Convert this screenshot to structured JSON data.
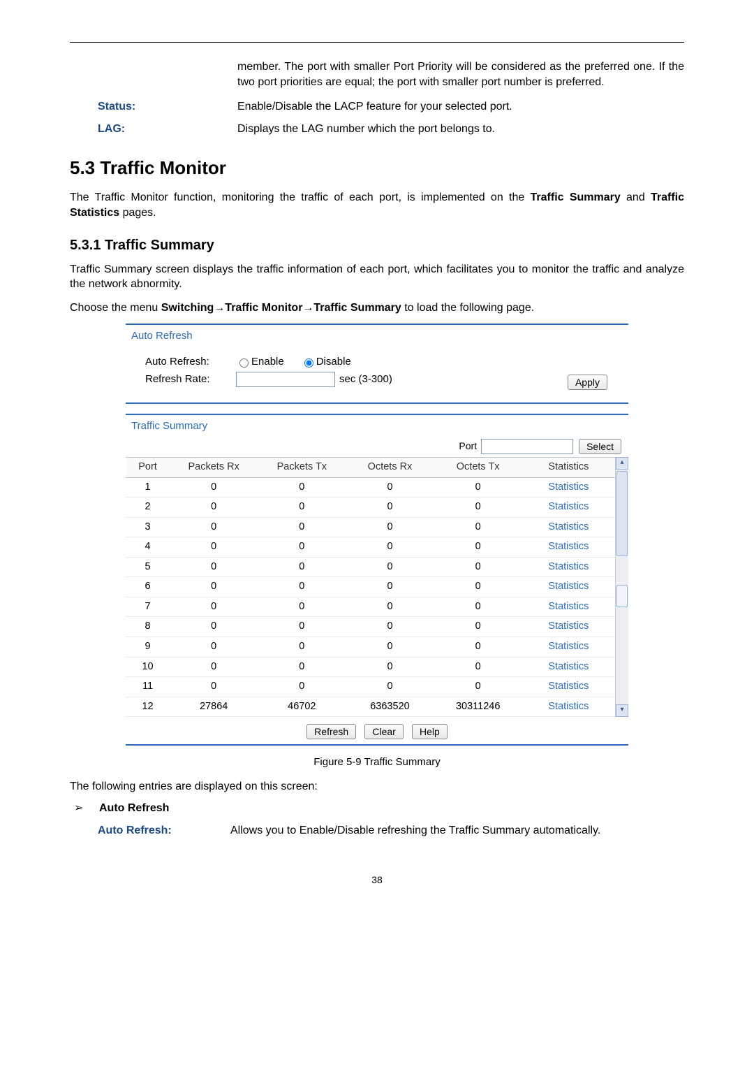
{
  "top_continuation": "member. The port with smaller Port Priority will be considered as the preferred one. If the two port priorities are equal; the port with smaller port number is preferred.",
  "defs": {
    "status_label": "Status:",
    "status_text": "Enable/Disable the LACP feature for your selected port.",
    "lag_label": "LAG:",
    "lag_text": "Displays the LAG number which the port belongs to."
  },
  "sec_heading": "5.3  Traffic Monitor",
  "sec_intro": "The Traffic Monitor function, monitoring the traffic of each port, is implemented on the Traffic Summary and Traffic Statistics pages.",
  "sub_heading": "5.3.1 Traffic Summary",
  "sub_intro": "Traffic Summary screen displays the traffic information of each port, which facilitates you to monitor the traffic and analyze the network abnormity.",
  "menu_path_line": "Choose the menu Switching→Traffic Monitor→Traffic Summary to load the following page.",
  "auto_refresh": {
    "header": "Auto Refresh",
    "label": "Auto Refresh:",
    "enable": "Enable",
    "disable": "Disable",
    "rate_label": "Refresh Rate:",
    "rate_unit": "sec (3-300)",
    "apply": "Apply"
  },
  "traffic_summary": {
    "header": "Traffic Summary",
    "port_label": "Port",
    "select_btn": "Select",
    "columns": [
      "Port",
      "Packets Rx",
      "Packets Tx",
      "Octets Rx",
      "Octets Tx",
      "Statistics"
    ],
    "rows": [
      {
        "port": "1",
        "prx": "0",
        "ptx": "0",
        "orx": "0",
        "otx": "0",
        "stat": "Statistics"
      },
      {
        "port": "2",
        "prx": "0",
        "ptx": "0",
        "orx": "0",
        "otx": "0",
        "stat": "Statistics"
      },
      {
        "port": "3",
        "prx": "0",
        "ptx": "0",
        "orx": "0",
        "otx": "0",
        "stat": "Statistics"
      },
      {
        "port": "4",
        "prx": "0",
        "ptx": "0",
        "orx": "0",
        "otx": "0",
        "stat": "Statistics"
      },
      {
        "port": "5",
        "prx": "0",
        "ptx": "0",
        "orx": "0",
        "otx": "0",
        "stat": "Statistics"
      },
      {
        "port": "6",
        "prx": "0",
        "ptx": "0",
        "orx": "0",
        "otx": "0",
        "stat": "Statistics"
      },
      {
        "port": "7",
        "prx": "0",
        "ptx": "0",
        "orx": "0",
        "otx": "0",
        "stat": "Statistics"
      },
      {
        "port": "8",
        "prx": "0",
        "ptx": "0",
        "orx": "0",
        "otx": "0",
        "stat": "Statistics"
      },
      {
        "port": "9",
        "prx": "0",
        "ptx": "0",
        "orx": "0",
        "otx": "0",
        "stat": "Statistics"
      },
      {
        "port": "10",
        "prx": "0",
        "ptx": "0",
        "orx": "0",
        "otx": "0",
        "stat": "Statistics"
      },
      {
        "port": "11",
        "prx": "0",
        "ptx": "0",
        "orx": "0",
        "otx": "0",
        "stat": "Statistics"
      },
      {
        "port": "12",
        "prx": "27864",
        "ptx": "46702",
        "orx": "6363520",
        "otx": "30311246",
        "stat": "Statistics"
      }
    ],
    "refresh_btn": "Refresh",
    "clear_btn": "Clear",
    "help_btn": "Help"
  },
  "figure_caption": "Figure 5-9 Traffic Summary",
  "entries_line": "The following entries are displayed on this screen:",
  "bullet_heading": "Auto Refresh",
  "sub_def": {
    "label": "Auto Refresh:",
    "text": "Allows you to Enable/Disable refreshing the Traffic Summary automatically."
  },
  "page_number": "38"
}
